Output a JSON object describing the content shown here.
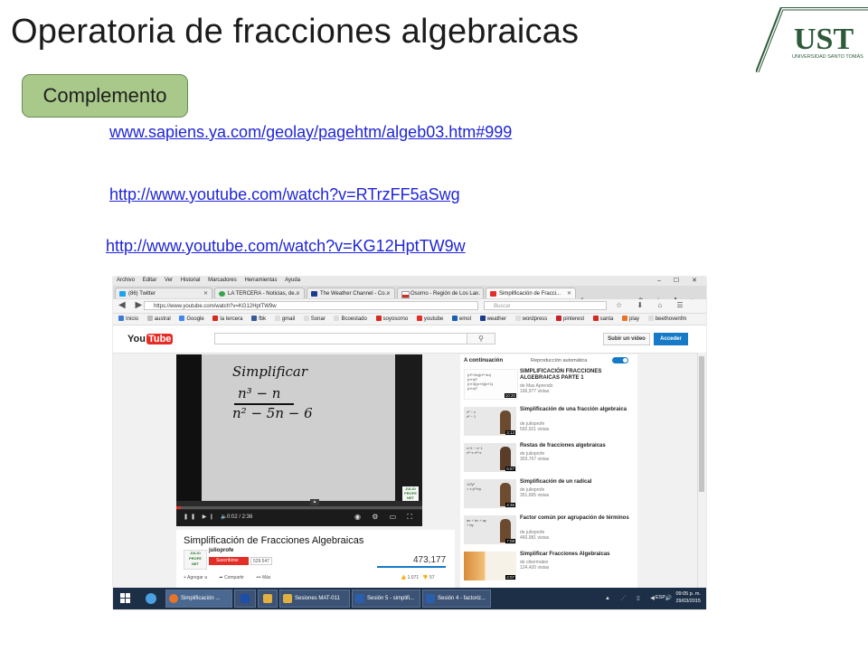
{
  "slide": {
    "title": "Operatoria de fracciones algebraicas",
    "badge": "Complemento",
    "logo": {
      "name": "UST",
      "subtitle": "UNIVERSIDAD SANTO TOMÁS",
      "color": "#2e5a3a"
    },
    "links": [
      "www.sapiens.ya.com/geolay/pagehtm/algeb03.htm#999",
      "http://www.youtube.com/watch?v=RTrzFF5aSwg",
      "http://www.youtube.com/watch?v=KG12HptTW9w"
    ],
    "link_color": "#1f25d8"
  },
  "browser": {
    "menu": [
      "Archivo",
      "Editar",
      "Ver",
      "Historial",
      "Marcadores",
      "Herramientas",
      "Ayuda"
    ],
    "tabs": [
      {
        "label": "(86) Twitter",
        "icon": "twitter-icon",
        "color": "#1da1f2"
      },
      {
        "label": "LA TERCERA - Noticias, de...",
        "icon": "loading-icon",
        "color": "#3aa34a"
      },
      {
        "label": "The Weather Channel - Co...",
        "icon": "weather-icon",
        "color": "#1a3a8a"
      },
      {
        "label": "Osorno - Región de Los La...",
        "icon": "chile-flag-icon",
        "color": "#d52b1e"
      },
      {
        "label": "Simplificación de Fracci...",
        "icon": "youtube-icon",
        "color": "#e52d27",
        "active": true
      }
    ],
    "url": "https://www.youtube.com/watch?v=KG12HptTW9w",
    "search_placeholder": "Buscar",
    "bookmarks": [
      "Inicio",
      "austral",
      "Google",
      "la tercera",
      "fbk",
      "gmail",
      "Sonar",
      "Bcoestado",
      "soyosorno",
      "youtube",
      "emol",
      "weather",
      "wordpress",
      "pinterest",
      "santa",
      "play",
      "beethovenfm"
    ]
  },
  "youtube": {
    "upload_label": "Subir un vídeo",
    "login_label": "Acceder",
    "board_text": [
      "Simplificar",
      "n³ − n",
      "n² − 5n − 6"
    ],
    "player_time": "0:02 / 2:36",
    "progress": 0.02,
    "video_title": "Simplificación de Fracciones Algebraicas",
    "channel": "julioprofe",
    "subscribe_label": "Suscribirse",
    "subscriber_count": "529.547",
    "view_count": "473,177",
    "actions": [
      "Agregar a",
      "Compartir",
      "Más"
    ],
    "likes": "1.071",
    "dislikes": "57",
    "next_label": "A continuación",
    "autoplay_label": "Reproducción automática",
    "recommendations": [
      {
        "title": "SIMPLIFICACIÓN FRACCIONES ALGEBRAICAS PARTE 1",
        "channel": "de Mas Aprendo",
        "views": "166,977 vistas",
        "duration": "10:20"
      },
      {
        "title": "Simplificación de una fracción algebraica",
        "channel": "de julioprofe",
        "views": "592,921 vistas",
        "duration": "3:13"
      },
      {
        "title": "Restas de fracciones algebraicas",
        "channel": "de julioprofe",
        "views": "303,767 vistas",
        "duration": "6:57"
      },
      {
        "title": "Simplificación de un radical",
        "channel": "de julioprofe",
        "views": "351,665 vistas",
        "duration": "4:36"
      },
      {
        "title": "Factor común por agrupación de términos",
        "channel": "de julioprofe",
        "views": "460,981 vistas",
        "duration": "7:09"
      },
      {
        "title": "Simplificar Fracciones Algebraicas",
        "channel": "de cibermatex",
        "views": "124,420 vistas",
        "duration": "4:07"
      }
    ]
  },
  "taskbar": {
    "items": [
      {
        "label": "Simplificación ...",
        "color": "#e8742a"
      },
      {
        "label": "",
        "color": "#1d4ea8"
      },
      {
        "label": "",
        "color": "#e0b040"
      },
      {
        "label": "Sesiones MAT-011",
        "color": "#e0b040"
      },
      {
        "label": "Sesión 5 - simplifi...",
        "color": "#2b5fae"
      },
      {
        "label": "Sesión 4 - factoriz...",
        "color": "#2b5fae"
      }
    ],
    "language": "ESP",
    "time": "09:05 p. m.",
    "date": "29/03/2015"
  }
}
